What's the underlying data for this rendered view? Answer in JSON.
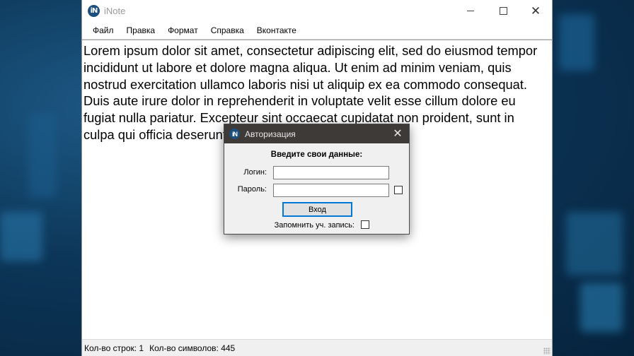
{
  "window": {
    "title": "iNote",
    "icon": "inote-logo-icon",
    "icon_text": "iN"
  },
  "menu": [
    "Файл",
    "Правка",
    "Формат",
    "Справка",
    "Вконтакте"
  ],
  "editor": {
    "text": "Lorem ipsum dolor sit amet, consectetur adipiscing elit, sed do eiusmod tempor incididunt ut labore et dolore magna aliqua. Ut enim ad minim veniam, quis nostrud exercitation ullamco laboris nisi ut aliquip ex ea commodo consequat. Duis aute irure dolor in reprehenderit in voluptate velit esse cillum dolore eu fugiat nulla pariatur. Excepteur sint occaecat cupidatat non proident, sunt in culpa qui officia deserunt mollit anim id est laborum."
  },
  "status": {
    "lines": "Кол-во строк: 1",
    "chars": "Кол-во символов: 445"
  },
  "dialog": {
    "title": "Авторизация",
    "heading": "Введите свои данные:",
    "login_label": "Логин:",
    "password_label": "Пароль:",
    "login_value": "",
    "password_value": "",
    "submit_label": "Вход",
    "remember_label": "Запомнить уч. запись:"
  },
  "colors": {
    "dialog_titlebar": "#3d3a38",
    "accent": "#0078d7",
    "desktop": "#0c3557"
  }
}
